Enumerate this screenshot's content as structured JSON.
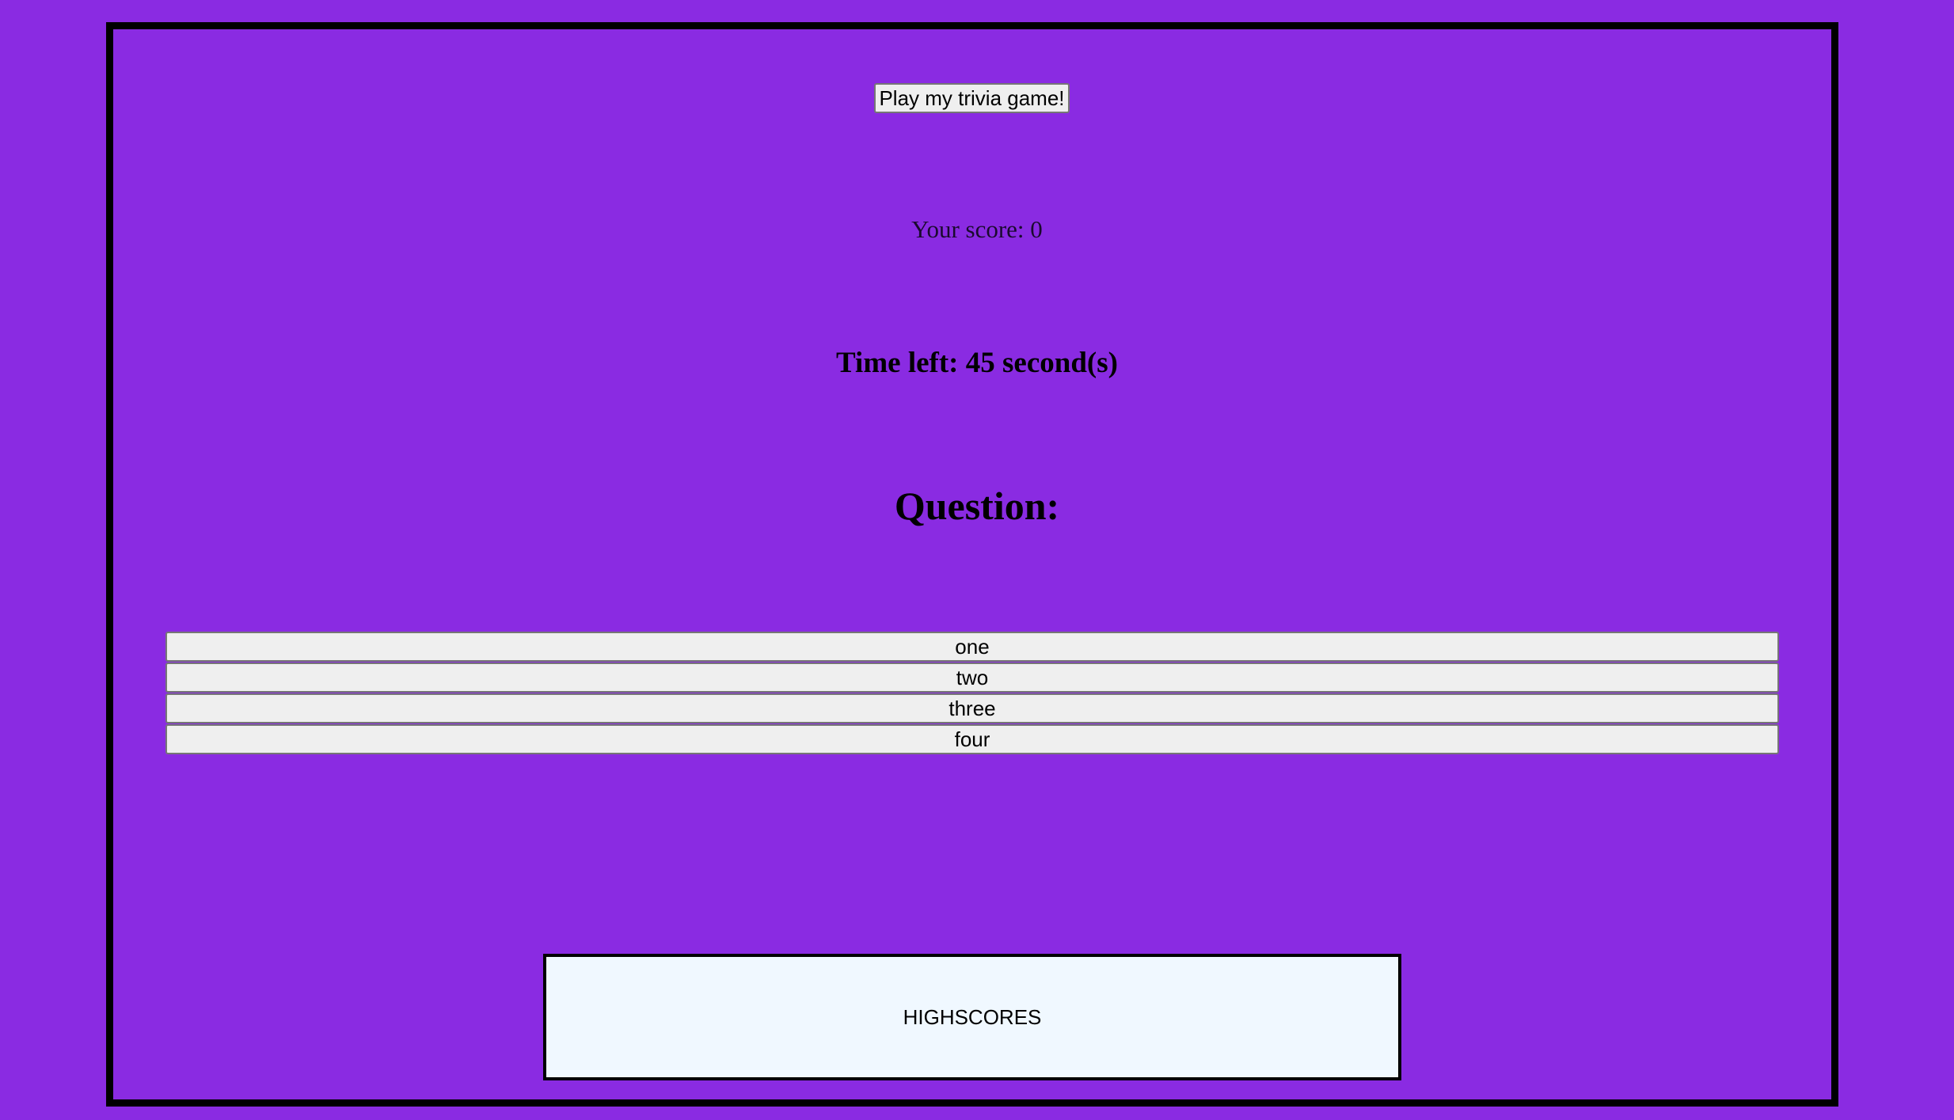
{
  "game": {
    "play_label": "Play my trivia game!",
    "score_text": "Your score: 0",
    "timer_text": "Time left: 45 second(s)",
    "question_text": "Question:",
    "answers": [
      "one",
      "two",
      "three",
      "four"
    ],
    "highscores_label": "HIGHSCORES"
  },
  "colors": {
    "background": "#8a2be2",
    "frame_border": "#000000",
    "button_bg": "#efefef",
    "highscores_bg": "#f0f8ff"
  }
}
